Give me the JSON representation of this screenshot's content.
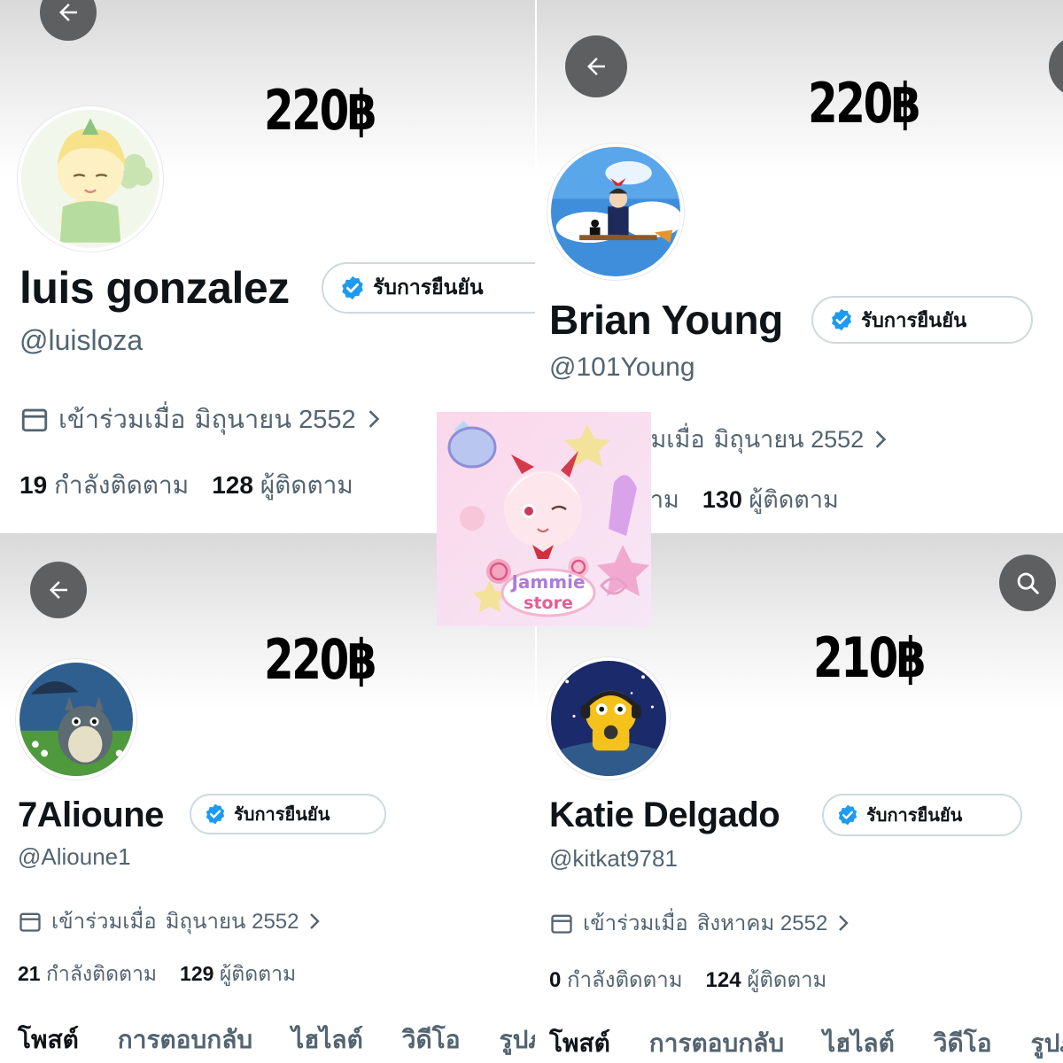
{
  "verify_label": "รับการยืนยัน",
  "joined_prefix": "เข้าร่วมเมื่อ",
  "following_label": "กำลังติดตาม",
  "followers_label": "ผู้ติดตาม",
  "accent": "#1d9bf0",
  "profiles": [
    {
      "price": "220฿",
      "name": "luis gonzalez",
      "handle": "@luisloza",
      "joined_date": "มิถุนายน 2552",
      "following": "19",
      "followers": "128",
      "header_icon": "back-arrow-icon"
    },
    {
      "price": "220฿",
      "name": "Brian Young",
      "handle": "@101Young",
      "joined_date": "มิถุนายน 2552",
      "following": "",
      "followers": "130",
      "header_icon": "back-arrow-icon"
    },
    {
      "price": "220฿",
      "name": "7Alioune",
      "handle": "@Alioune1",
      "joined_date": "มิถุนายน 2552",
      "following": "21",
      "followers": "129",
      "header_icon": "back-arrow-icon"
    },
    {
      "price": "210฿",
      "name": "Katie Delgado",
      "handle": "@kitkat9781",
      "joined_date": "สิงหาคม 2552",
      "following": "0",
      "followers": "124",
      "header_icon": "search-icon"
    }
  ],
  "tabs": [
    "โพสต์",
    "การตอบกลับ",
    "ไฮไลต์",
    "วิดีโอ",
    "รูปภาพ"
  ],
  "center_logo": {
    "line1": "Jammie",
    "line2": "store"
  }
}
